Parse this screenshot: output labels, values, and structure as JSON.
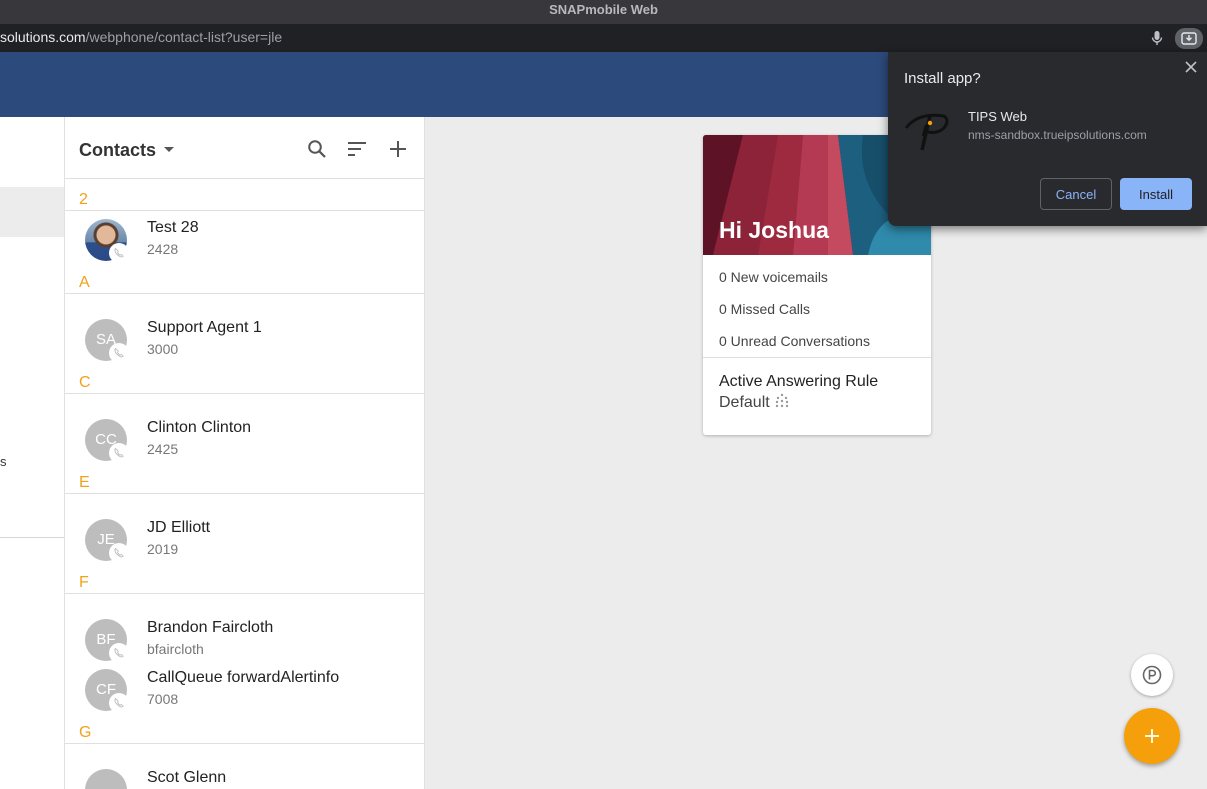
{
  "window": {
    "title": "SNAPmobile Web"
  },
  "address_bar": {
    "url_host": "solutions.com",
    "url_path": "/webphone/contact-list?user=jle"
  },
  "left_nav": {
    "stub_text": "s"
  },
  "contacts": {
    "title": "Contacts",
    "sections": [
      {
        "letter": "2",
        "entries": [
          {
            "name": "Test 28",
            "number": "2428",
            "avatar": "photo",
            "initials": ""
          }
        ]
      },
      {
        "letter": "A",
        "entries": [
          {
            "name": "Support Agent 1",
            "number": "3000",
            "avatar": "initials",
            "initials": "SA"
          }
        ]
      },
      {
        "letter": "C",
        "entries": [
          {
            "name": "Clinton Clinton",
            "number": "2425",
            "avatar": "initials",
            "initials": "CC"
          }
        ]
      },
      {
        "letter": "E",
        "entries": [
          {
            "name": "JD Elliott",
            "number": "2019",
            "avatar": "initials",
            "initials": "JE"
          }
        ]
      },
      {
        "letter": "F",
        "entries": [
          {
            "name": "Brandon Faircloth",
            "number": "bfaircloth",
            "avatar": "initials",
            "initials": "BF"
          },
          {
            "name": "CallQueue forwardAlertinfo",
            "number": "7008",
            "avatar": "initials",
            "initials": "CF"
          }
        ]
      },
      {
        "letter": "G",
        "entries": [
          {
            "name": "Scot Glenn",
            "number": "",
            "avatar": "initials",
            "initials": ""
          }
        ]
      }
    ]
  },
  "dashboard": {
    "greeting": "Hi Joshua",
    "voicemails": "0 New voicemails",
    "missed_calls": "0 Missed Calls",
    "unread": "0 Unread Conversations",
    "answering_rule_title": "Active Answering Rule",
    "answering_rule_value": "Default"
  },
  "install_popup": {
    "title": "Install app?",
    "app_name": "TIPS Web",
    "app_domain": "nms-sandbox.trueipsolutions.com",
    "cancel_label": "Cancel",
    "install_label": "Install"
  },
  "colors": {
    "header": "#2d4a7c",
    "accent": "#f5a00a",
    "section_letter": "#f2a21a",
    "popup_bg": "#292a2d",
    "popup_button": "#8ab4f8"
  }
}
